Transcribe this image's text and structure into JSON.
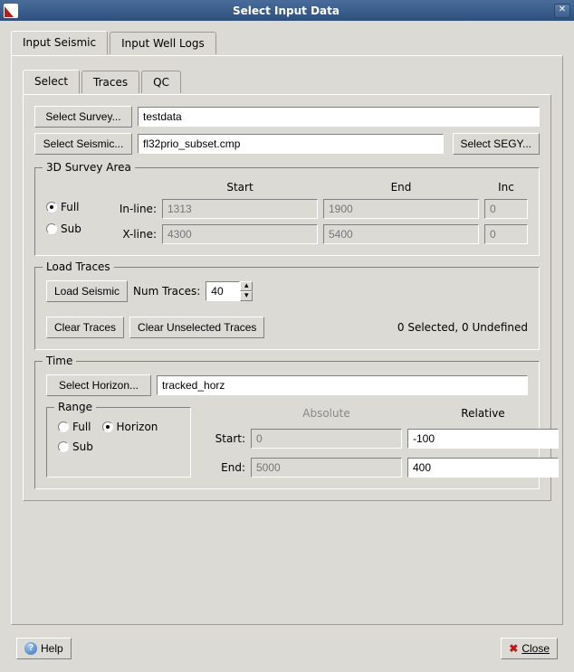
{
  "window": {
    "title": "Select Input Data"
  },
  "outer_tabs": {
    "input_seismic": "Input Seismic",
    "input_well_logs": "Input Well Logs"
  },
  "inner_tabs": {
    "select": "Select",
    "traces": "Traces",
    "qc": "QC"
  },
  "survey": {
    "select_survey_btn": "Select Survey...",
    "survey_value": "testdata",
    "select_seismic_btn": "Select Seismic...",
    "seismic_value": "fl32prio_subset.cmp",
    "select_segy_btn": "Select SEGY..."
  },
  "area": {
    "legend": "3D Survey Area",
    "full_label": "Full",
    "sub_label": "Sub",
    "header_start": "Start",
    "header_end": "End",
    "header_inc": "Inc",
    "inline_label": "In-line:",
    "xline_label": "X-line:",
    "inline_start": "1313",
    "inline_end": "1900",
    "inline_inc": "0",
    "xline_start": "4300",
    "xline_end": "5400",
    "xline_inc": "0"
  },
  "load": {
    "legend": "Load Traces",
    "load_btn": "Load Seismic",
    "num_label": "Num Traces:",
    "num_value": "40",
    "clear_btn": "Clear Traces",
    "clear_un_btn": "Clear Unselected Traces",
    "status": "0 Selected, 0 Undefined"
  },
  "time": {
    "legend": "Time",
    "select_horizon_btn": "Select Horizon...",
    "horizon_value": "tracked_horz",
    "range_legend": "Range",
    "full_label": "Full",
    "horizon_label": "Horizon",
    "sub_label": "Sub",
    "absolute_label": "Absolute",
    "relative_label": "Relative",
    "start_label": "Start:",
    "end_label": "End:",
    "abs_start": "0",
    "abs_end": "5000",
    "rel_start": "-100",
    "rel_end": "400"
  },
  "bottom": {
    "help": "Help",
    "close": "Close"
  }
}
